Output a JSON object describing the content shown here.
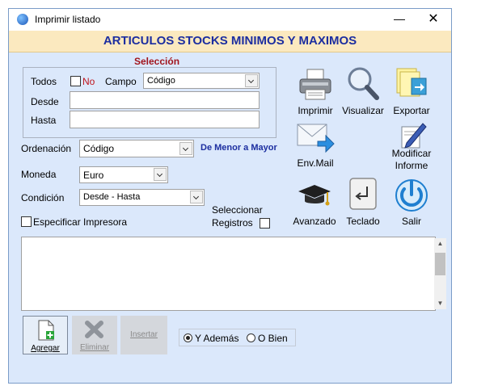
{
  "window": {
    "title": "Imprimir listado"
  },
  "header": {
    "title": "ARTICULOS STOCKS MINIMOS Y MAXIMOS"
  },
  "seleccion": {
    "title": "Selección",
    "todos_label": "Todos",
    "no_label": "No",
    "campo_label": "Campo",
    "campo_value": "Código",
    "desde_label": "Desde",
    "desde_value": "",
    "hasta_label": "Hasta",
    "hasta_value": ""
  },
  "ordenacion": {
    "label": "Ordenación",
    "value": "Código",
    "direction": "De Menor a Mayor"
  },
  "moneda": {
    "label": "Moneda",
    "value": "Euro"
  },
  "condicion": {
    "label": "Condición",
    "value": "Desde - Hasta"
  },
  "especificar_impresora": "Especificar Impresora",
  "seleccionar_registros": {
    "line1": "Seleccionar",
    "line2": "Registros"
  },
  "toolbar": {
    "imprimir": "Imprimir",
    "visualizar": "Visualizar",
    "exportar": "Exportar",
    "envmail": "Env.Mail",
    "modificar_1": "Modificar",
    "modificar_2": "Informe",
    "avanzado": "Avanzado",
    "teclado": "Teclado",
    "salir": "Salir"
  },
  "bottom": {
    "agregar": "Agregar",
    "eliminar": "Eliminar",
    "insertar": "Insertar",
    "y_ademas": "Y Además",
    "o_bien": "O Bien"
  },
  "colors": {
    "header_bg": "#fbe9bf",
    "title_blue": "#1c2ea0",
    "accent_red": "#a1141c",
    "window_bg": "#dbe8fb"
  }
}
